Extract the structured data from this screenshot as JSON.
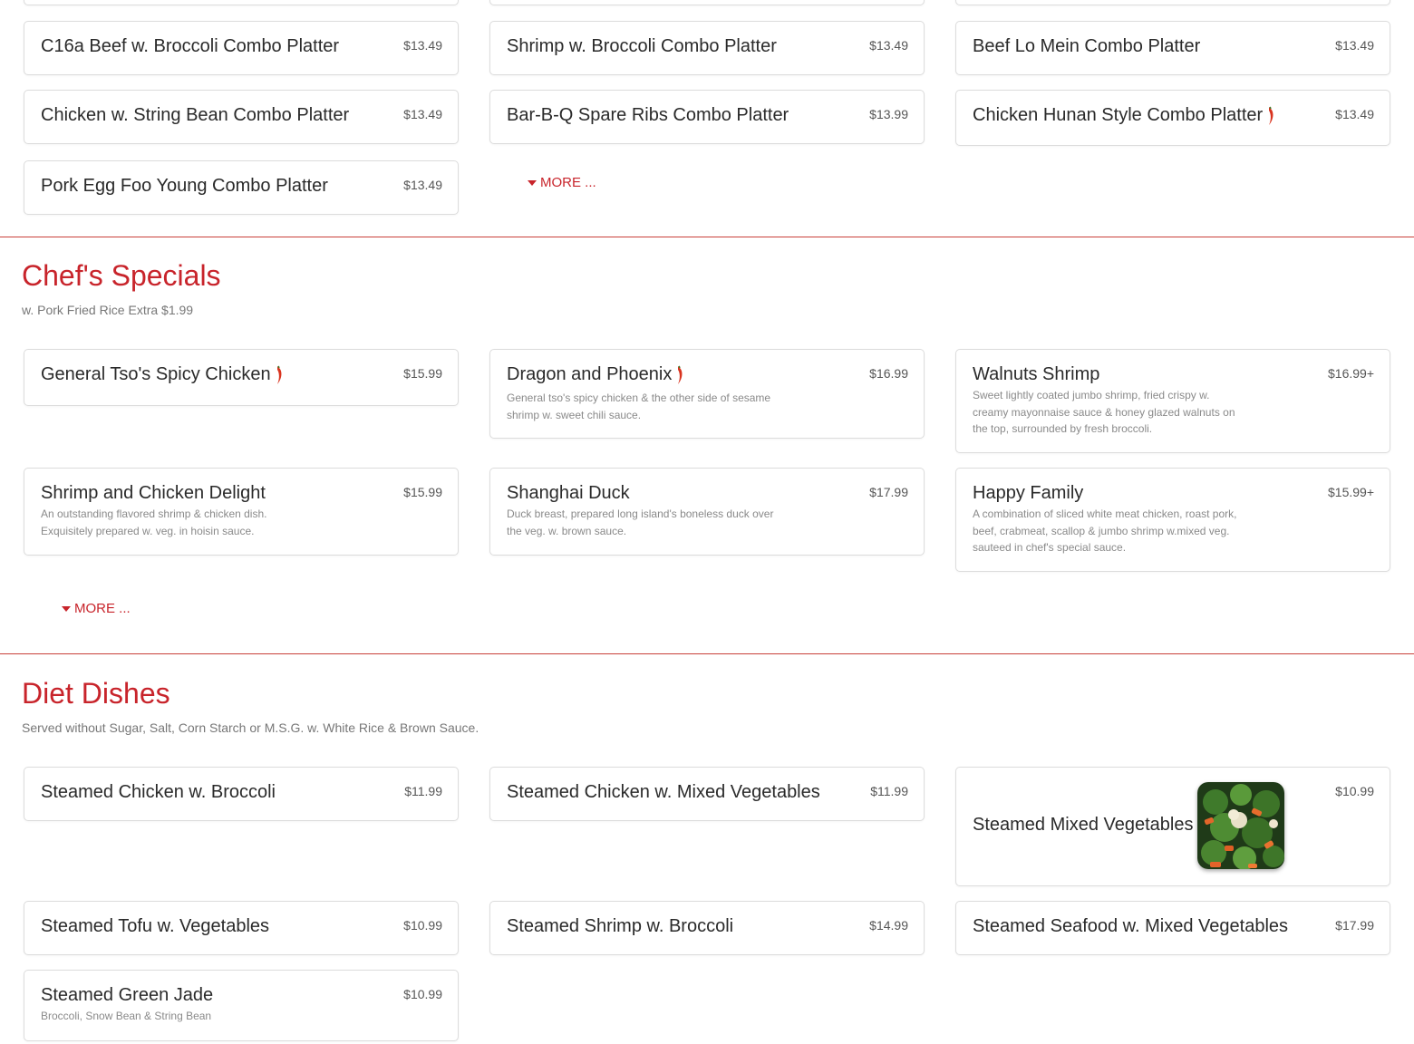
{
  "colors": {
    "accent": "#c8242b",
    "rule": "#c9403a"
  },
  "combo": {
    "items": [
      {
        "name": "C16a Beef w. Broccoli Combo Platter",
        "price": "$13.49"
      },
      {
        "name": "Shrimp w. Broccoli Combo Platter",
        "price": "$13.49"
      },
      {
        "name": "Beef Lo Mein Combo Platter",
        "price": "$13.49"
      },
      {
        "name": "Chicken w. String Bean Combo Platter",
        "price": "$13.49"
      },
      {
        "name": "Bar-B-Q Spare Ribs Combo Platter",
        "price": "$13.99"
      },
      {
        "name": "Chicken Hunan Style Combo Platter",
        "price": "$13.49",
        "icon": "chili-pepper-icon"
      },
      {
        "name": "Pork Egg Foo Young Combo Platter",
        "price": "$13.49"
      }
    ],
    "more_label": "MORE ..."
  },
  "chefs": {
    "title": "Chef's Specials",
    "subtitle": "w. Pork Fried Rice Extra $1.99",
    "items": [
      {
        "name": "General Tso's Spicy Chicken",
        "price": "$15.99",
        "icon": "chili-pepper-icon"
      },
      {
        "name": "Dragon and Phoenix",
        "price": "$16.99",
        "icon": "chili-pepper-icon",
        "desc": "General tso's spicy chicken & the other side of sesame shrimp w. sweet chili sauce."
      },
      {
        "name": "Walnuts Shrimp",
        "price": "$16.99+",
        "desc": "Sweet lightly coated jumbo shrimp, fried crispy w. creamy mayonnaise sauce & honey glazed walnuts on the top, surrounded by fresh broccoli."
      },
      {
        "name": "Shrimp and Chicken Delight",
        "price": "$15.99",
        "desc": "An outstanding flavored shrimp & chicken dish. Exquisitely prepared w. veg. in hoisin sauce."
      },
      {
        "name": "Shanghai Duck",
        "price": "$17.99",
        "desc": "Duck breast, prepared long island's boneless duck over the veg. w. brown sauce."
      },
      {
        "name": "Happy Family",
        "price": "$15.99+",
        "desc": "A combination of sliced white meat chicken, roast pork, beef, crabmeat, scallop & jumbo shrimp w.mixed veg. sauteed in chef's special sauce."
      }
    ],
    "more_label": "MORE ..."
  },
  "diet": {
    "title": "Diet Dishes",
    "subtitle": "Served without Sugar, Salt, Corn Starch or M.S.G. w. White Rice & Brown Sauce.",
    "items": [
      {
        "name": "Steamed Chicken w. Broccoli",
        "price": "$11.99"
      },
      {
        "name": "Steamed Chicken w. Mixed Vegetables",
        "price": "$11.99"
      },
      {
        "name": "Steamed Mixed Vegetables",
        "price": "$10.99",
        "image": "mixed-vegetables-photo"
      },
      {
        "name": "Steamed Tofu w. Vegetables",
        "price": "$10.99"
      },
      {
        "name": "Steamed Shrimp w. Broccoli",
        "price": "$14.99"
      },
      {
        "name": "Steamed Seafood w. Mixed Vegetables",
        "price": "$17.99"
      },
      {
        "name": "Steamed Green Jade",
        "price": "$10.99",
        "desc": "Broccoli, Snow Bean & String Bean"
      }
    ]
  }
}
